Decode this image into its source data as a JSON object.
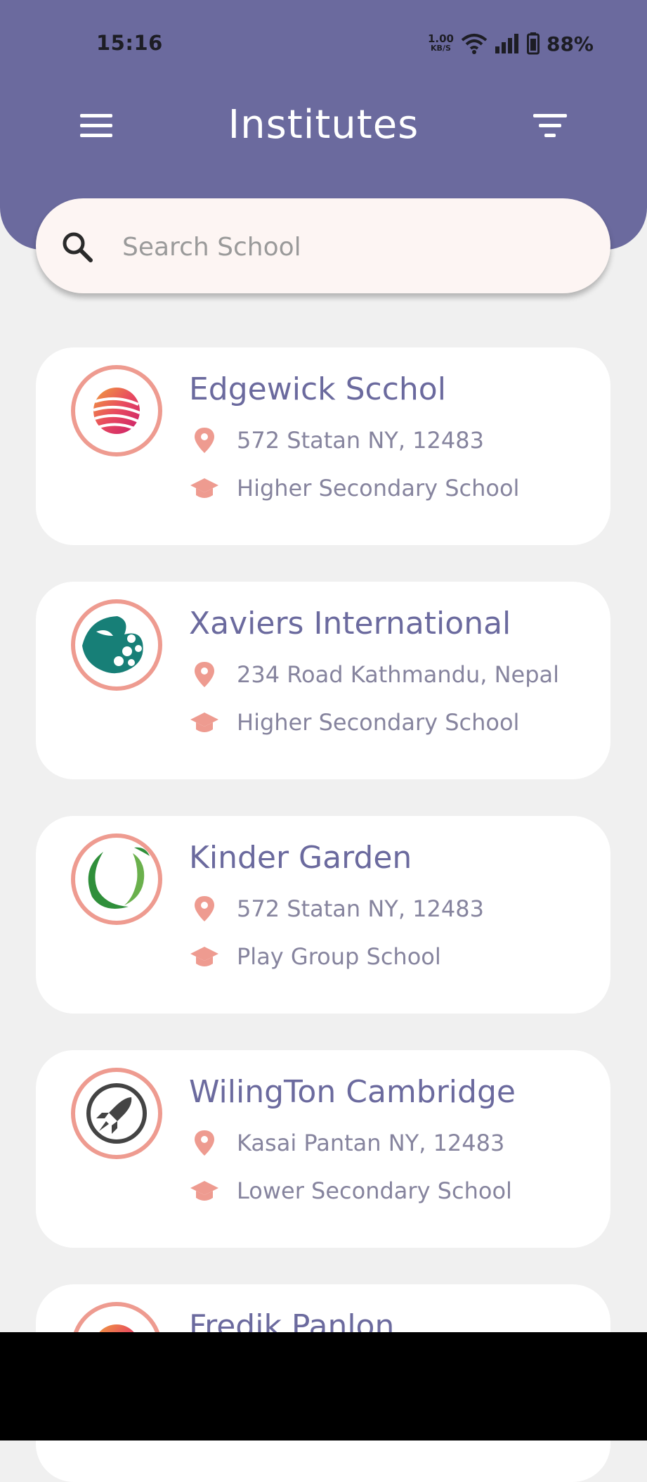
{
  "status_bar": {
    "time": "15:16",
    "net_speed_value": "1.00",
    "net_speed_unit": "KB/S",
    "battery": "88%"
  },
  "header": {
    "title": "Institutes",
    "background_color": "#6b6a9e",
    "menu_icon": "hamburger-menu-icon",
    "filter_icon": "filter-icon"
  },
  "search": {
    "placeholder": "Search School",
    "value": "",
    "icon": "search-icon"
  },
  "accent_color": "#ee9b90",
  "institutes": [
    {
      "name": "Edgewick Scchol",
      "address": "572 Statan NY, 12483",
      "type": "Higher Secondary School",
      "logo": "striped-sphere-logo"
    },
    {
      "name": "Xaviers International",
      "address": "234 Road Kathmandu, Nepal",
      "type": "Higher Secondary School",
      "logo": "teal-leaf-logo"
    },
    {
      "name": "Kinder Garden",
      "address": "572 Statan NY, 12483",
      "type": "Play Group School",
      "logo": "green-swirl-logo"
    },
    {
      "name": "WilingTon Cambridge",
      "address": "Kasai Pantan NY, 12483",
      "type": "Lower Secondary School",
      "logo": "rocket-logo"
    },
    {
      "name": "Fredik Panlon",
      "address": "",
      "type": "",
      "logo": "striped-sphere-logo"
    }
  ]
}
